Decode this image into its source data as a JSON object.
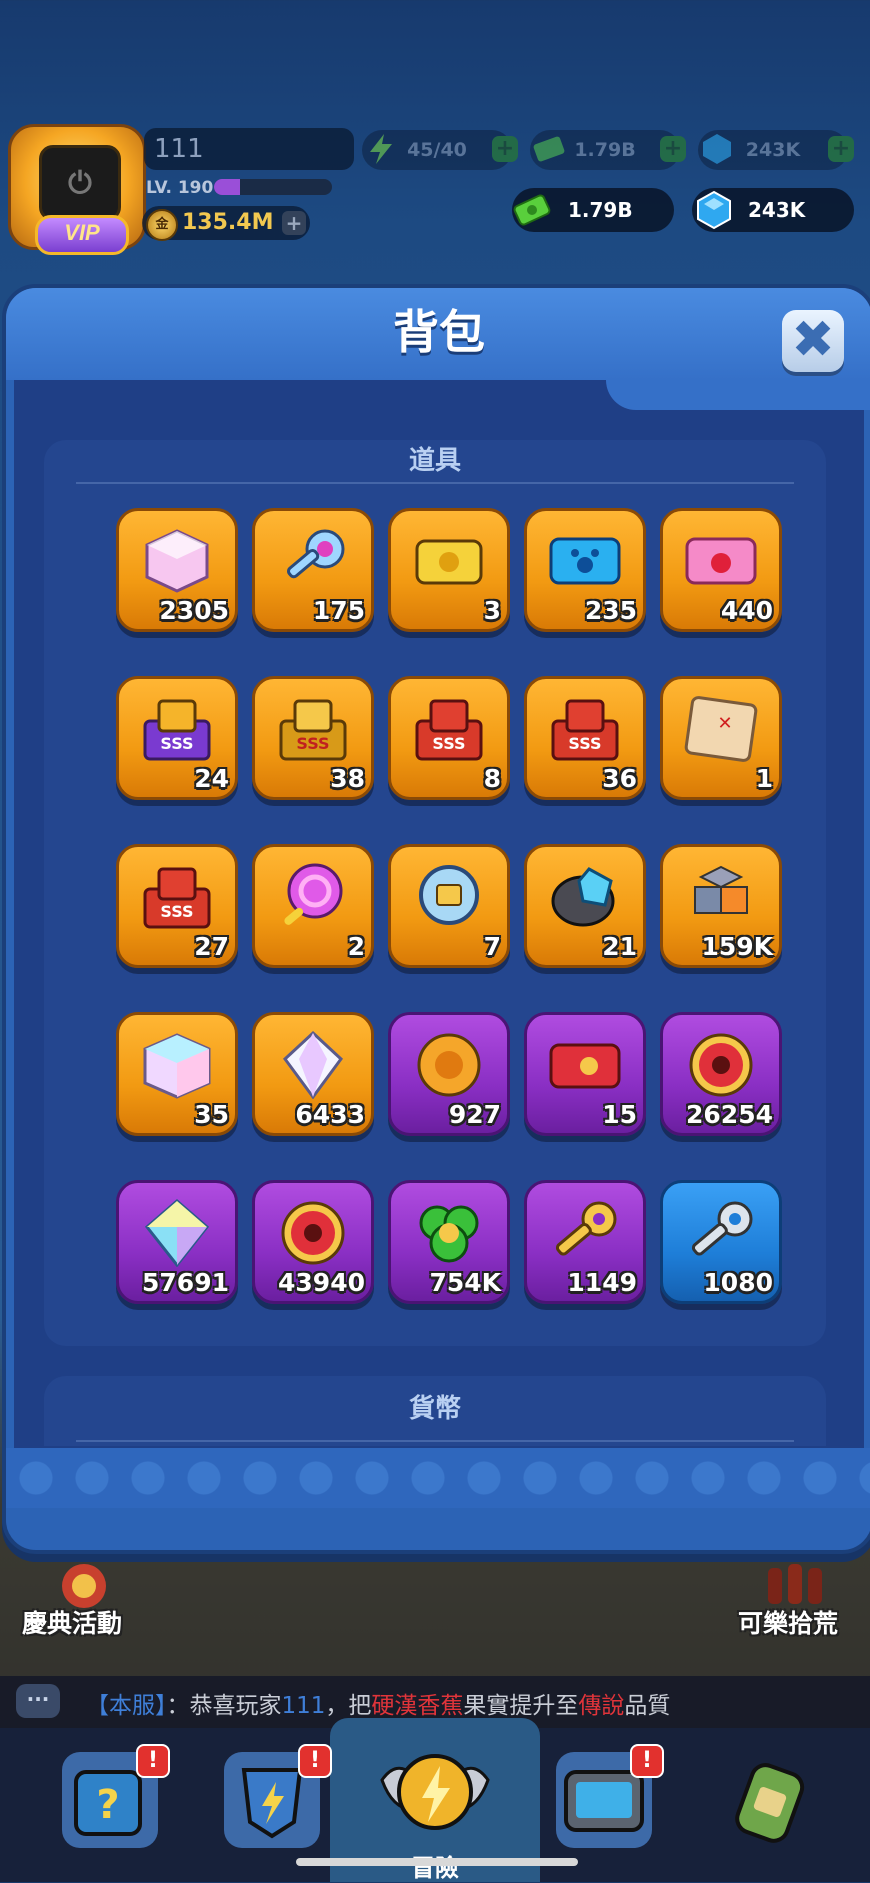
{
  "player": {
    "name": "111",
    "level_label": "LV. 190",
    "level_progress": 0.22,
    "vip_label": "VIP",
    "coins": "135.4M"
  },
  "hud_stats": {
    "energy": "45/40",
    "cash_dim": "1.79B",
    "gems_dim": "243K",
    "cash": "1.79B",
    "gems": "243K"
  },
  "modal": {
    "title": "背包",
    "section_items_title": "道具",
    "section_currency_title": "貨幣"
  },
  "items": [
    {
      "icon": "crystal-cube-pink-icon",
      "count": "2305",
      "tile": "orange"
    },
    {
      "icon": "pink-gem-key-icon",
      "count": "175",
      "tile": "orange"
    },
    {
      "icon": "yellow-ticket-icon",
      "count": "3",
      "tile": "orange"
    },
    {
      "icon": "blue-paw-ticket-icon",
      "count": "235",
      "tile": "orange"
    },
    {
      "icon": "pink-apple-ticket-icon",
      "count": "440",
      "tile": "orange"
    },
    {
      "icon": "sss-card-pack-purple-icon",
      "count": "24",
      "tile": "orange"
    },
    {
      "icon": "sss-card-pack-gold-icon",
      "count": "38",
      "tile": "orange"
    },
    {
      "icon": "sss-card-pack-red-icon",
      "count": "8",
      "tile": "orange"
    },
    {
      "icon": "sss-card-pack-red-icon",
      "count": "36",
      "tile": "orange"
    },
    {
      "icon": "treasure-map-icon",
      "count": "1",
      "tile": "orange"
    },
    {
      "icon": "sss-card-pack-red-icon",
      "count": "27",
      "tile": "orange"
    },
    {
      "icon": "lollipop-icon",
      "count": "2",
      "tile": "orange"
    },
    {
      "icon": "magnifier-chest-icon",
      "count": "7",
      "tile": "orange"
    },
    {
      "icon": "blue-ore-icon",
      "count": "21",
      "tile": "orange"
    },
    {
      "icon": "cube-stack-icon",
      "count": "159K",
      "tile": "orange"
    },
    {
      "icon": "rainbow-cube-icon",
      "count": "35",
      "tile": "orange"
    },
    {
      "icon": "white-diamond-icon",
      "count": "6433",
      "tile": "orange"
    },
    {
      "icon": "flower-medal-icon",
      "count": "927",
      "tile": "purple"
    },
    {
      "icon": "red-skull-ticket-icon",
      "count": "15",
      "tile": "purple"
    },
    {
      "icon": "red-skull-coin-icon",
      "count": "26254",
      "tile": "purple"
    },
    {
      "icon": "rainbow-diamond-icon",
      "count": "57691",
      "tile": "purple"
    },
    {
      "icon": "red-skull-coin-icon",
      "count": "43940",
      "tile": "purple"
    },
    {
      "icon": "green-clover-coin-icon",
      "count": "754K",
      "tile": "purple"
    },
    {
      "icon": "gold-key-icon",
      "count": "1149",
      "tile": "purple"
    },
    {
      "icon": "silver-key-icon",
      "count": "1080",
      "tile": "blue"
    }
  ],
  "events": {
    "left_label": "慶典活動",
    "right_label": "可樂拾荒"
  },
  "chat": {
    "server_tag": "【本服】",
    "sep": "：",
    "msg_part1": "恭喜玩家",
    "msg_player": "111",
    "msg_part2": "，把",
    "msg_item": "硬漢香蕉",
    "msg_part3": "果實提升至",
    "msg_quality": "傳說",
    "msg_part4": "品質"
  },
  "nav": {
    "center_label": "冒險",
    "badge": "!"
  },
  "colors": {
    "modal_bg": "#2c63b5",
    "panel_bg": "#24468f",
    "tile_orange": "#f29a12",
    "tile_purple": "#8a2fc4",
    "tile_blue": "#1e7ed8"
  }
}
